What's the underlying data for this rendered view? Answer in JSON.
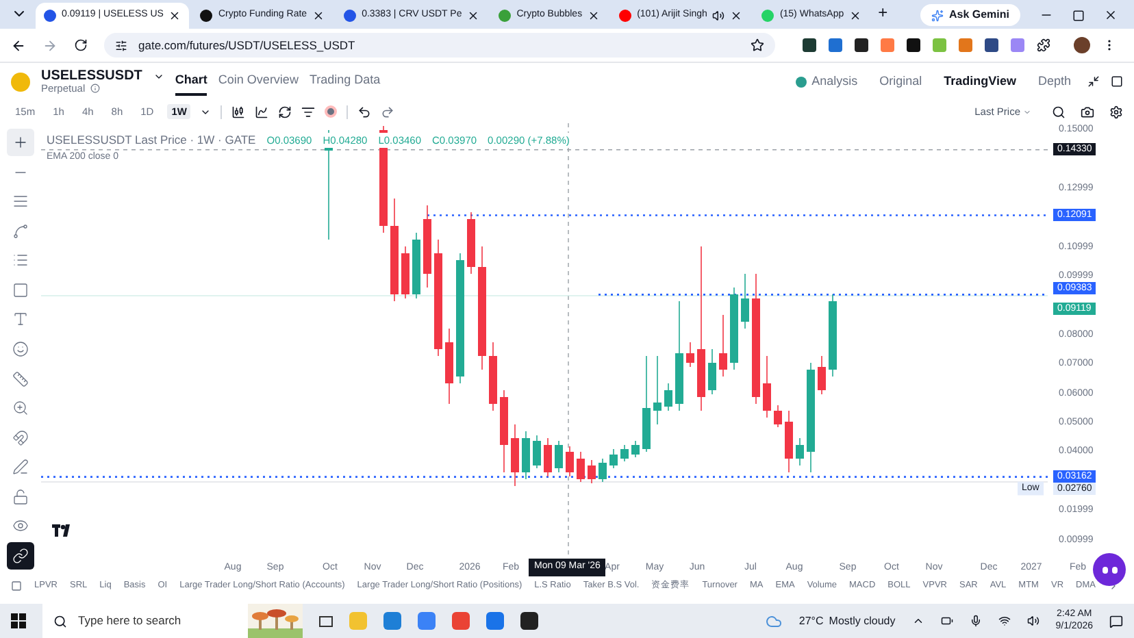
{
  "browser": {
    "tabs": [
      {
        "title": "0.09119 | USELESS US",
        "kind": "gate",
        "selected": true
      },
      {
        "title": "Crypto Funding Rate",
        "kind": "dark",
        "selected": false
      },
      {
        "title": "0.3383 | CRV USDT Pe",
        "kind": "gate",
        "selected": false
      },
      {
        "title": "Crypto Bubbles",
        "kind": "bubbles",
        "selected": false
      },
      {
        "title": "(101) Arijit Singh",
        "kind": "youtube",
        "selected": false,
        "audio": true
      },
      {
        "title": "(15) WhatsApp",
        "kind": "whatsapp",
        "selected": false
      }
    ],
    "new_tab": "+",
    "ask_gemini": "Ask Gemini",
    "url": "gate.com/futures/USDT/USELESS_USDT"
  },
  "header": {
    "symbol": "USELESSUSDT",
    "subtitle": "Perpetual",
    "nav": [
      {
        "label": "Chart",
        "selected": true
      },
      {
        "label": "Coin Overview",
        "selected": false
      },
      {
        "label": "Trading Data",
        "selected": false
      }
    ],
    "views": [
      {
        "label": "Analysis",
        "kind": "analysis",
        "selected": false
      },
      {
        "label": "Original",
        "kind": "plain",
        "selected": false
      },
      {
        "label": "TradingView",
        "kind": "plain",
        "selected": true
      },
      {
        "label": "Depth",
        "kind": "plain",
        "selected": false
      }
    ]
  },
  "toolbar": {
    "intervals": [
      {
        "label": "15m",
        "selected": false
      },
      {
        "label": "1h",
        "selected": false
      },
      {
        "label": "4h",
        "selected": false
      },
      {
        "label": "8h",
        "selected": false
      },
      {
        "label": "1D",
        "selected": false
      },
      {
        "label": "1W",
        "selected": true
      }
    ],
    "price_type": "Last Price"
  },
  "tools": [
    {
      "kind": "crosshair",
      "selected": true
    },
    {
      "kind": "line",
      "selected": false
    },
    {
      "kind": "channel",
      "selected": false
    },
    {
      "kind": "pattern",
      "selected": false
    },
    {
      "kind": "fib",
      "selected": false
    },
    {
      "kind": "shape",
      "selected": false
    },
    {
      "kind": "text",
      "selected": false
    },
    {
      "kind": "emoji",
      "selected": false
    },
    {
      "kind": "ruler",
      "selected": false
    },
    {
      "kind": "zoom",
      "selected": false
    },
    {
      "kind": "magnet",
      "selected": false
    },
    {
      "kind": "pencil",
      "selected": false
    },
    {
      "kind": "lock",
      "selected": false
    },
    {
      "kind": "eye",
      "selected": false
    },
    {
      "kind": "link",
      "selected": true
    }
  ],
  "legend": {
    "title": "USELESSUSDT Last Price · 1W · GATE",
    "ohlc": [
      "O0.03690",
      "H0.04280",
      "L0.03460",
      "C0.03970",
      "0.00290 (+7.88%)"
    ],
    "ema": "EMA 200 close 0"
  },
  "y_axis": [
    "0.15000",
    "0.12999",
    "0.10999",
    "0.09999",
    "0.08000",
    "0.07000",
    "0.06000",
    "0.05000",
    "0.04000",
    "0.01999",
    "0.00999"
  ],
  "price_tags": [
    {
      "value": "0.14330",
      "kind": "cursor",
      "color": "#131722"
    },
    {
      "value": "0.12091",
      "kind": "line",
      "color": "#2962ff"
    },
    {
      "value": "0.09383",
      "kind": "line",
      "color": "#2962ff"
    },
    {
      "value": "0.09119",
      "kind": "last",
      "color": "#22ab94"
    },
    {
      "value": "0.03162",
      "kind": "line",
      "color": "#2962ff"
    },
    {
      "value": "0.02760",
      "kind": "low",
      "label": "Low",
      "color": "#e3ecfb"
    }
  ],
  "x_axis": [
    "Aug",
    "Sep",
    "Oct",
    "Nov",
    "Dec",
    "2026",
    "Feb",
    "Apr",
    "May",
    "Jun",
    "Jul",
    "Aug",
    "Sep",
    "Oct",
    "Nov",
    "Dec",
    "2027",
    "Feb"
  ],
  "cursor_date": "Mon 09 Mar '26",
  "indicators": [
    "LPVR",
    "SRL",
    "Liq",
    "Basis",
    "OI",
    "Large Trader Long/Short Ratio (Accounts)",
    "Large Trader Long/Short Ratio (Positions)",
    "L.S Ratio",
    "Taker B.S Vol.",
    "资金费率",
    "Turnover",
    "MA",
    "EMA",
    "Volume",
    "MACD",
    "BOLL",
    "VPVR",
    "SAR",
    "AVL",
    "MTM",
    "VR",
    "DMA"
  ],
  "taskbar": {
    "search_placeholder": "Type here to search",
    "temperature": "27°C",
    "weather": "Mostly cloudy",
    "time": "2:42 AM",
    "date": "9/1/2026"
  }
}
